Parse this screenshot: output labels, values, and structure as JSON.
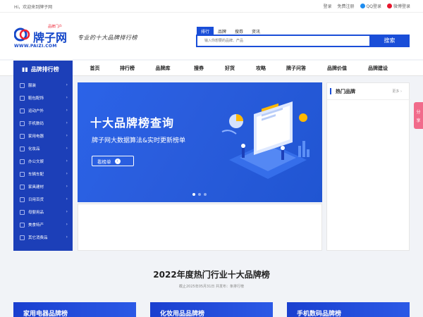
{
  "topbar": {
    "welcome": "Hi，欢迎来到牌子网",
    "login": "登录",
    "register": "免费注册",
    "qq_login": "QQ登录",
    "weibo_login": "微博登录"
  },
  "header": {
    "logo_name": "牌子网",
    "logo_badge": "品牌门户",
    "logo_url": "WWW.PAIZI.COM",
    "slogan": "专业的十大品牌排行榜"
  },
  "search": {
    "tabs": [
      "排行",
      "品牌",
      "搜券",
      "资讯"
    ],
    "active_tab": 0,
    "placeholder": "输入你想要的品牌、产品",
    "button": "搜索"
  },
  "nav": {
    "category_label": "品牌排行榜",
    "items": [
      "首页",
      "排行榜",
      "品牌库",
      "搜券",
      "好货",
      "攻略",
      "牌子问答",
      "品牌价值",
      "品牌建设"
    ]
  },
  "sidebar": {
    "items": [
      "服装",
      "鞋包配饰",
      "运动户外",
      "手机数码",
      "家用电器",
      "化妆品",
      "办公文娱",
      "车辆车配",
      "家具建材",
      "日用百货",
      "母婴用品",
      "美食特产",
      "其它消费品"
    ]
  },
  "banner": {
    "title": "十大品牌榜查询",
    "subtitle": "牌子网大数据算法&实时更新榜单",
    "button": "看榜单",
    "active_dot": 0,
    "dot_count": 3
  },
  "hot_brands": {
    "title": "热门品牌",
    "more": "更多"
  },
  "share": {
    "chars": [
      "分",
      "享"
    ]
  },
  "section": {
    "title": "2022年度热门行业十大品牌榜",
    "subtitle": "截止2025年05月31日 共发布：条排行榜"
  },
  "cards": [
    "家用电器品牌榜",
    "化妆用品品牌榜",
    "手机数码品牌榜"
  ],
  "colors": {
    "primary": "#1a4ed8",
    "sidebar": "#1c3fb8",
    "share": "#f16b8b"
  }
}
